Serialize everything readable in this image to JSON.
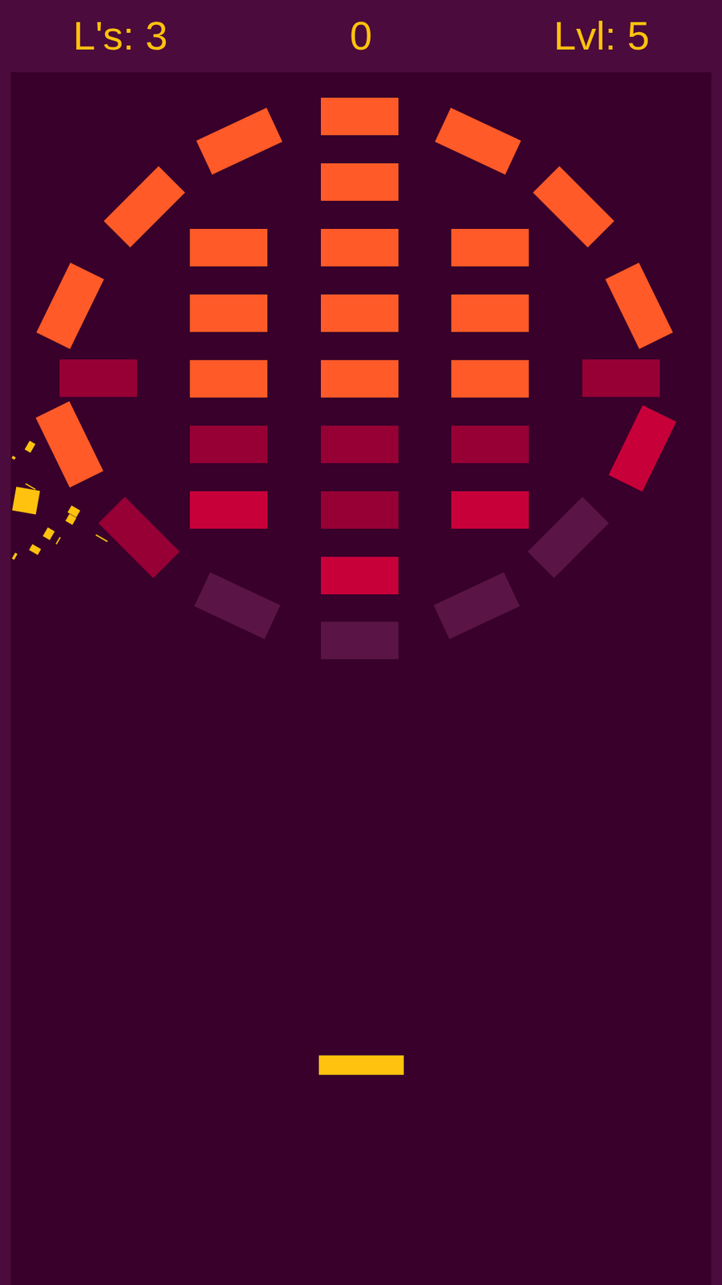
{
  "hud": {
    "lives": "L's: 3",
    "score": "0",
    "level": "Lvl: 5"
  },
  "ring": [
    {
      "color": "#ff5a28"
    },
    {
      "color": "#ff5a28"
    },
    {
      "color": "#ff5a28"
    },
    {
      "color": "#ff5a28"
    },
    {
      "color": "#960035"
    },
    {
      "color": "#c8003a"
    },
    {
      "color": "#5a1446"
    },
    {
      "color": "#5a1446"
    },
    {
      "color": "#5a1446"
    },
    {
      "color": "#5a1446"
    },
    {
      "color": "#960035"
    },
    {
      "color": "#ff5a28"
    },
    {
      "color": "#960035"
    },
    {
      "color": "#ff5a28"
    },
    {
      "color": "#ff5a28"
    },
    {
      "color": "#ff5a28"
    }
  ],
  "columns": [
    [
      {
        "color": "#ff5a28"
      },
      {
        "color": "#ff5a28"
      },
      {
        "color": "#ff5a28"
      },
      {
        "color": "#960035"
      },
      {
        "color": "#c8003a"
      }
    ],
    [
      {
        "color": "#ff5a28"
      },
      {
        "color": "#ff5a28"
      },
      {
        "color": "#ff5a28"
      },
      {
        "color": "#ff5a28"
      },
      {
        "color": "#960035"
      },
      {
        "color": "#960035"
      },
      {
        "color": "#c8003a"
      }
    ],
    [
      {
        "color": "#ff5a28"
      },
      {
        "color": "#ff5a28"
      },
      {
        "color": "#ff5a28"
      },
      {
        "color": "#960035"
      },
      {
        "color": "#c8003a"
      }
    ]
  ],
  "ball": {
    "bursting": true
  }
}
